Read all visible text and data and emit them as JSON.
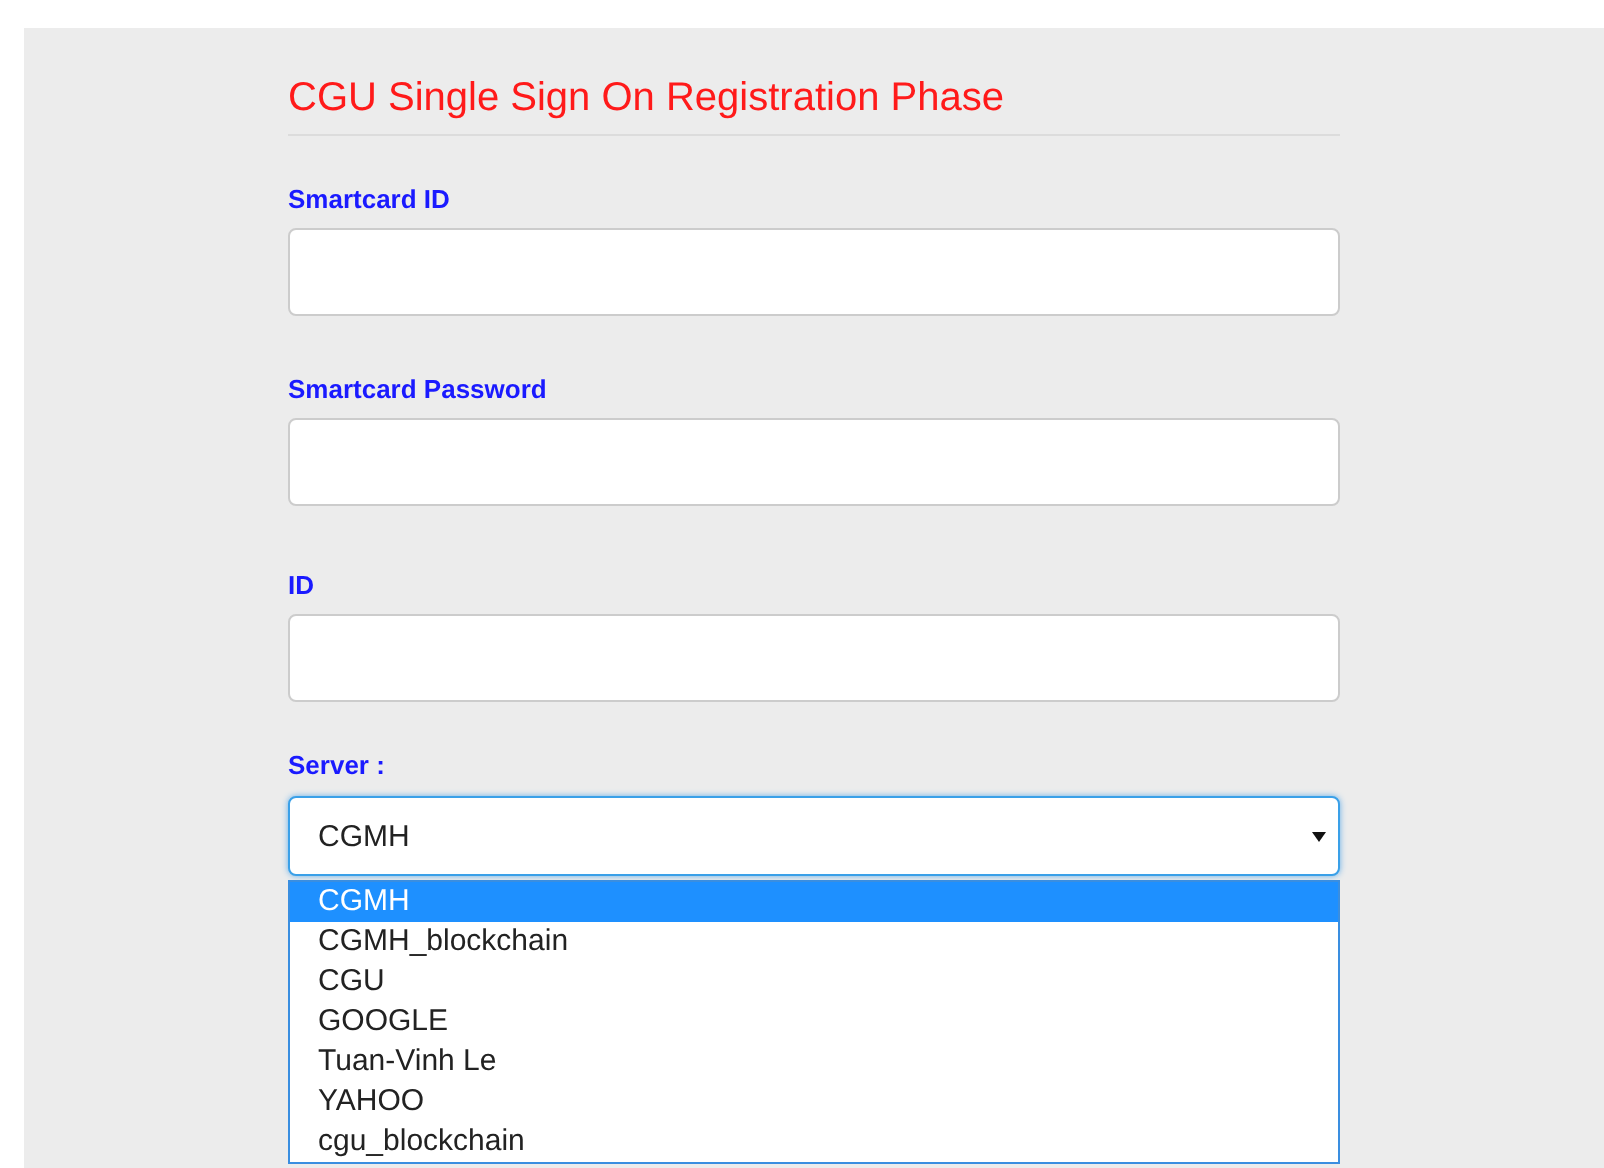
{
  "title": "CGU Single Sign On Registration Phase",
  "fields": [
    {
      "label": "Smartcard ID"
    },
    {
      "label": "Smartcard Password"
    },
    {
      "label": "ID"
    }
  ],
  "server": {
    "label": "Server :",
    "value": "CGMH",
    "expanded": true,
    "options": [
      {
        "label": "CGMH",
        "selected": true
      },
      {
        "label": "CGMH_blockchain",
        "selected": false
      },
      {
        "label": "CGU",
        "selected": false
      },
      {
        "label": "GOOGLE",
        "selected": false
      },
      {
        "label": "Tuan-Vinh Le",
        "selected": false
      },
      {
        "label": "YAHOO",
        "selected": false
      },
      {
        "label": "cgu_blockchain",
        "selected": false
      }
    ]
  }
}
